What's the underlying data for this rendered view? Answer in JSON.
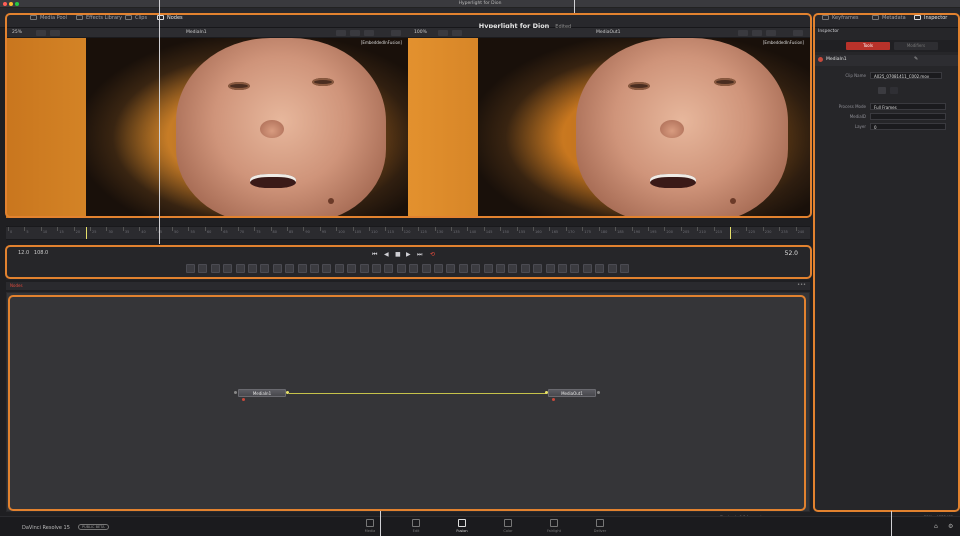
{
  "window": {
    "title": "Hyperlight for Dion"
  },
  "header": {
    "media_pool": "Media Pool",
    "effects_library": "Effects Library",
    "clips": "Clips",
    "nodes": "Nodes",
    "project_title": "Hyperlight for Dion",
    "project_status": "Edited",
    "keyframes": "Keyframes",
    "metadata": "Metadata",
    "inspector": "Inspector"
  },
  "viewers": {
    "left": {
      "zoom": "25%",
      "name": "MediaIn1",
      "label": "[EmbeddedInFusion]"
    },
    "right": {
      "zoom": "100%",
      "name": "MediaOut1",
      "label": "[EmbeddedInFusion]"
    }
  },
  "timeline": {
    "ruler_ticks": [
      "0",
      "5",
      "10",
      "15",
      "20",
      "25",
      "30",
      "35",
      "40",
      "45",
      "50",
      "55",
      "60",
      "65",
      "70",
      "75",
      "80",
      "85",
      "90",
      "95",
      "100",
      "105",
      "110",
      "115",
      "120",
      "125",
      "130",
      "135",
      "140",
      "145",
      "150",
      "155",
      "160",
      "165",
      "170",
      "175",
      "180",
      "185",
      "190",
      "195",
      "200",
      "205",
      "210",
      "215",
      "220",
      "225",
      "230",
      "235",
      "240"
    ],
    "in_point": "12.0",
    "out_point": "108.0",
    "current_frame": "52.0"
  },
  "nodes": {
    "editor_label": "Nodes",
    "items": [
      {
        "name": "MediaIn1"
      },
      {
        "name": "MediaOut1"
      }
    ]
  },
  "inspector": {
    "title": "Inspector",
    "tabs": [
      "Tools",
      "Modifiers"
    ],
    "node_name": "MediaIn1",
    "clip_name_label": "Clip Name",
    "clip_name_value": "A025_07081411_C002.mov",
    "process_mode_label": "Process Mode",
    "process_mode_value": "Full Frames",
    "mediaid_label": "MediaID",
    "layer_label": "Layer",
    "layer_value": "0"
  },
  "status": {
    "playback": "Playback: 0.8 frames/sec",
    "memory": "25% - 4873 MB"
  },
  "app": {
    "name": "DaVinci Resolve 15",
    "badge": "PUBLIC BETA"
  },
  "pages": [
    "Media",
    "Edit",
    "Fusion",
    "Color",
    "Fairlight",
    "Deliver"
  ],
  "active_page": "Fusion",
  "accent_color": "#e2822f"
}
